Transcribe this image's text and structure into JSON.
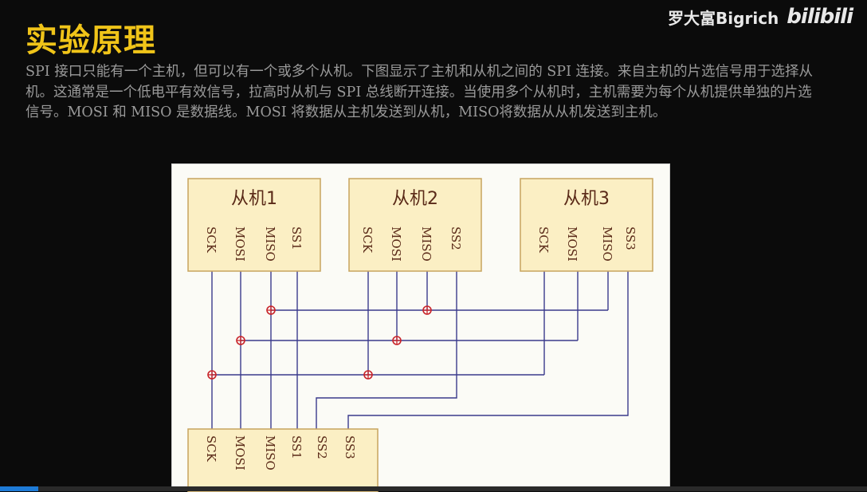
{
  "slide": {
    "title": "实验原理",
    "paragraph": "SPI 接口只能有一个主机，但可以有一个或多个从机。下图显示了主机和从机之间的 SPI 连接。来自主机的片选信号用于选择从机。这通常是一个低电平有效信号，拉高时从机与 SPI 总线断开连接。当使用多个从机时，主机需要为每个从机提供单独的片选信号。MOSI 和 MISO 是数据线。MOSI 将数据从主机发送到从机，MISO将数据从从机发送到主机。"
  },
  "watermark": {
    "channel": "罗大富Bigrich",
    "site_logo": "bilibili"
  },
  "diagram": {
    "slaves": [
      {
        "name": "从机1",
        "pins": [
          "SCK",
          "MOSI",
          "MISO",
          "SS1"
        ]
      },
      {
        "name": "从机2",
        "pins": [
          "SCK",
          "MOSI",
          "MISO",
          "SS2"
        ]
      },
      {
        "name": "从机3",
        "pins": [
          "SCK",
          "MOSI",
          "MISO",
          "SS3"
        ]
      }
    ],
    "master": {
      "pins": [
        "SCK",
        "MOSI",
        "MISO",
        "SS1",
        "SS2",
        "SS3"
      ]
    },
    "colors": {
      "box_fill": "#fbefc4",
      "box_stroke": "#c8a45e",
      "wire": "#3a3a8c",
      "junction": "#c8242a",
      "text": "#5a2a18"
    }
  }
}
